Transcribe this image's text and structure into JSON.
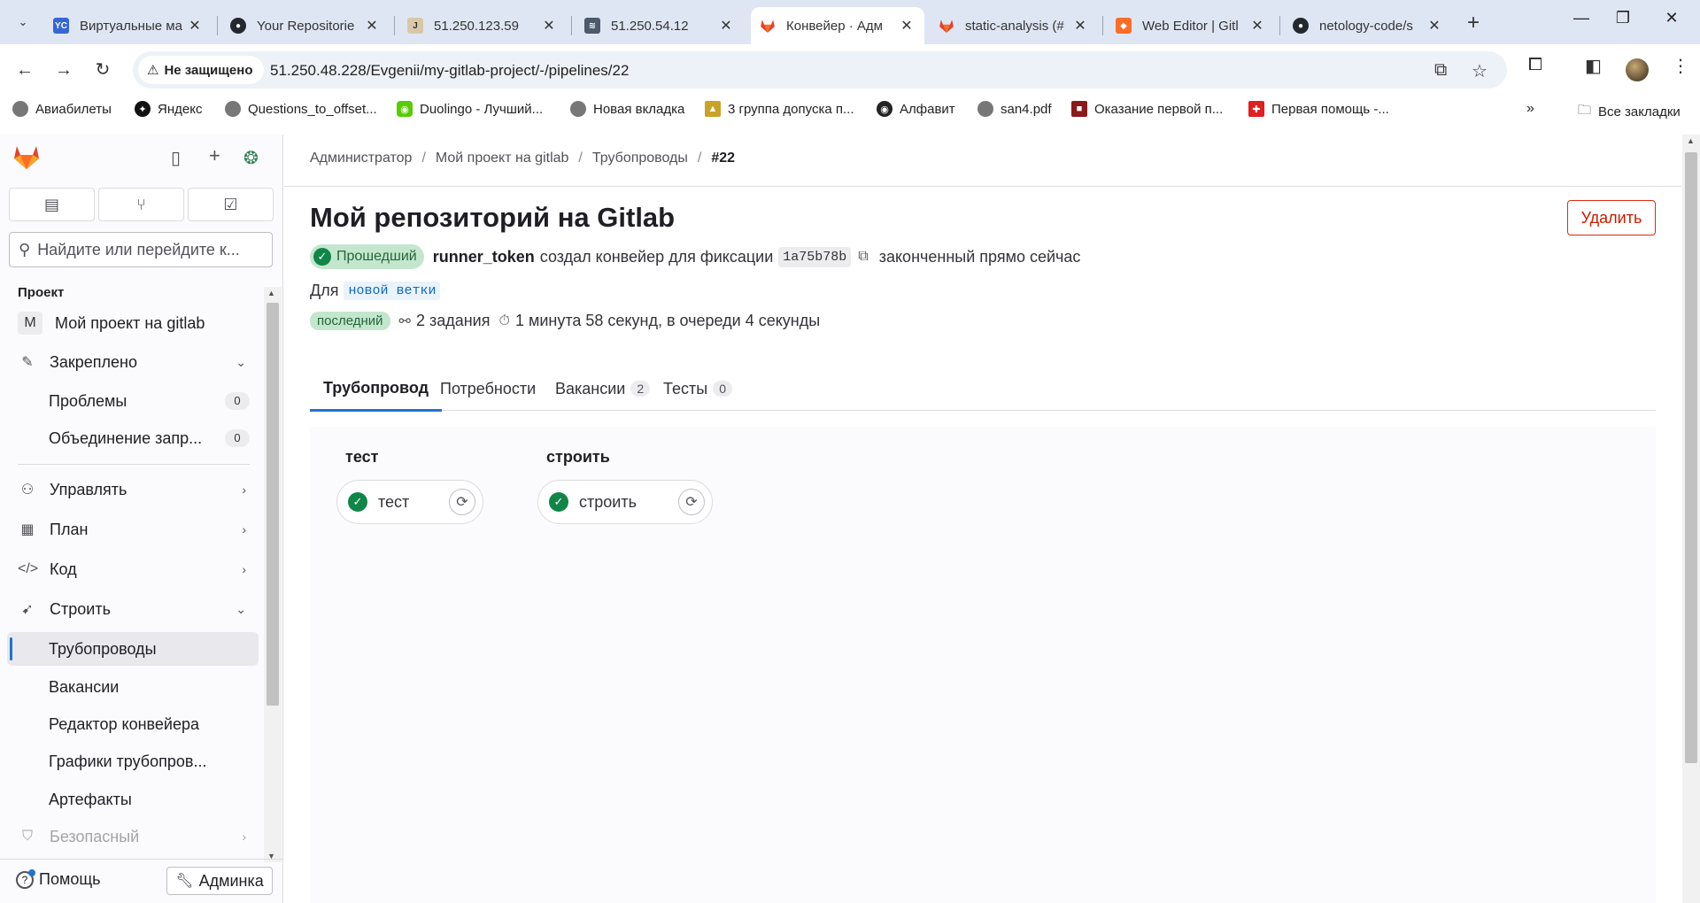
{
  "browser": {
    "tabs": [
      {
        "title": "Виртуальные ма",
        "icon": "yandex-cloud-icon",
        "color": "#3367d6"
      },
      {
        "title": "Your Repositorie",
        "icon": "github-icon",
        "color": "#24292f"
      },
      {
        "title": "51.250.123.59",
        "icon": "jenkins-icon",
        "color": "#d33833"
      },
      {
        "title": "51.250.54.12",
        "icon": "sonarqube-icon",
        "color": "#4c5a6b"
      },
      {
        "title": "Конвейер · Адм",
        "icon": "gitlab-icon",
        "color": "#e24329",
        "active": true
      },
      {
        "title": "static-analysis (#",
        "icon": "gitlab-icon",
        "color": "#e24329"
      },
      {
        "title": "Web Editor | Gitl",
        "icon": "gitlab-icon",
        "color": "#fc6d26"
      },
      {
        "title": "netology-code/s",
        "icon": "github-icon",
        "color": "#24292f"
      }
    ],
    "security_label": "Не защищено",
    "url": "51.250.48.228/Evgenii/my-gitlab-project/-/pipelines/22",
    "bookmarks": [
      {
        "label": "Авиабилеты",
        "color": "#777"
      },
      {
        "label": "Яндекс",
        "color": "#111"
      },
      {
        "label": "Questions_to_offset...",
        "color": "#777"
      },
      {
        "label": "Duolingo - Лучший...",
        "color": "#58cc02"
      },
      {
        "label": "Новая вкладка",
        "color": "#777"
      },
      {
        "label": "3 группа допуска п...",
        "color": "#c9a227"
      },
      {
        "label": "Алфавит",
        "color": "#222"
      },
      {
        "label": "san4.pdf",
        "color": "#777"
      },
      {
        "label": "Оказание первой п...",
        "color": "#8b1a1a"
      },
      {
        "label": "Первая помощь -...",
        "color": "#e01f1f"
      }
    ],
    "all_bookmarks_label": "Все закладки"
  },
  "sidebar": {
    "search_placeholder": "Найдите или перейдите к...",
    "section_label": "Проект",
    "project_initial": "M",
    "project_name": "Мой проект на gitlab",
    "items": [
      {
        "label": "Закреплено",
        "icon": "pin-icon",
        "chevron": "down"
      },
      {
        "label": "Проблемы",
        "count": "0",
        "sub": true
      },
      {
        "label": "Объединение запр...",
        "count": "0",
        "sub": true
      },
      {
        "label": "Управлять",
        "icon": "users-icon",
        "chevron": "right"
      },
      {
        "label": "План",
        "icon": "calendar-icon",
        "chevron": "right"
      },
      {
        "label": "Код",
        "icon": "code-icon",
        "chevron": "right"
      },
      {
        "label": "Строить",
        "icon": "rocket-icon",
        "chevron": "down"
      },
      {
        "label": "Трубопроводы",
        "sub": true,
        "active": true
      },
      {
        "label": "Вакансии",
        "sub": true
      },
      {
        "label": "Редактор конвейера",
        "sub": true
      },
      {
        "label": "Графики трубопров...",
        "sub": true
      },
      {
        "label": "Артефакты",
        "sub": true
      },
      {
        "label": "Безопасный",
        "icon": "shield-icon",
        "chevron": "right",
        "muted": true
      }
    ],
    "help_label": "Помощь",
    "admin_label": "Админка"
  },
  "main": {
    "breadcrumbs": [
      "Администратор",
      "Мой проект на gitlab",
      "Трубопроводы",
      "#22"
    ],
    "title": "Мой репозиторий на Gitlab",
    "delete_label": "Удалить",
    "status_label": "Прошедший",
    "user": "runner_token",
    "created_text": "создал конвейер для фиксации",
    "commit_sha": "1a75b78b",
    "finished_text": "законченный прямо сейчас",
    "for_label": "Для",
    "branch": "новой ветки",
    "latest_label": "последний",
    "jobs_text": "2 задания",
    "duration_text": "1 минута 58 секунд, в очереди 4 секунды",
    "tabs": [
      {
        "label": "Трубопровод",
        "active": true
      },
      {
        "label": "Потребности"
      },
      {
        "label": "Вакансии",
        "count": "2"
      },
      {
        "label": "Тесты",
        "count": "0"
      }
    ],
    "stages": [
      {
        "title": "тест",
        "job": "тест"
      },
      {
        "title": "строить",
        "job": "строить"
      }
    ],
    "accent_color": "#1f75cb",
    "success_color": "#108548"
  }
}
